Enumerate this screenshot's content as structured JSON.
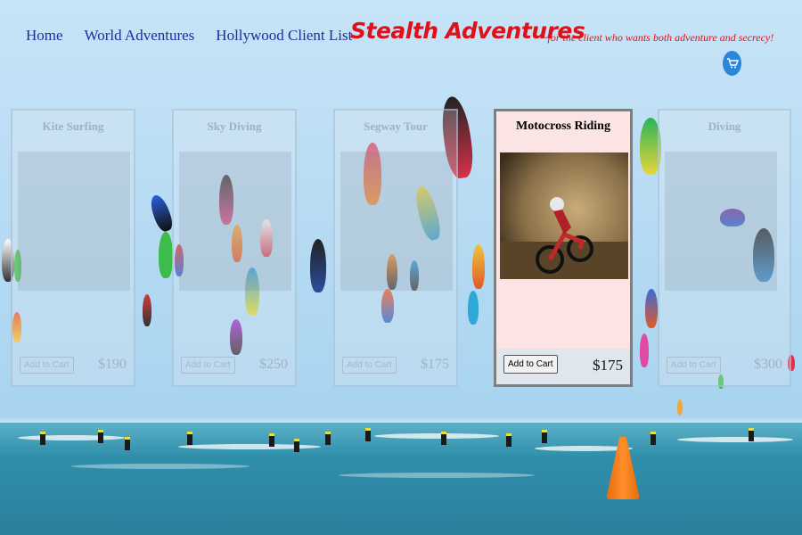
{
  "nav": {
    "items": [
      "Home",
      "World Adventures",
      "Hollywood Client List"
    ]
  },
  "brand": {
    "name": "Stealth Adventures",
    "tagline": "~for the client who wants both adventure and secrecy!"
  },
  "cart": {
    "icon": "shopping-cart-icon"
  },
  "products": [
    {
      "title": "Kite Surfing",
      "button": "Add to Cart",
      "price": "$190"
    },
    {
      "title": "Sky Diving",
      "button": "Add to Cart",
      "price": "$250"
    },
    {
      "title": "Segway Tour",
      "button": "Add to Cart",
      "price": "$175"
    },
    {
      "title": "Motocross Riding",
      "button": "Add to Cart",
      "price": "$175"
    },
    {
      "title": "Diving",
      "button": "Add to Cart",
      "price": "$300"
    }
  ],
  "colors": {
    "brand": "#e0101a",
    "nav": "#1a2fa0",
    "cart": "#2a86d8",
    "active_card_bg": "#fce4e4"
  }
}
